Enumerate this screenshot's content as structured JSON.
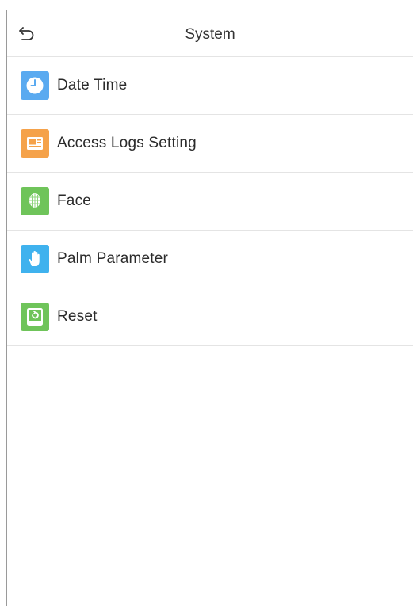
{
  "header": {
    "title": "System",
    "back_icon": "back-arrow-icon"
  },
  "menu": {
    "items": [
      {
        "label": "Date Time",
        "icon": "clock-icon",
        "icon_color": "#5aaaf0"
      },
      {
        "label": "Access Logs Setting",
        "icon": "logs-icon",
        "icon_color": "#f5a24a"
      },
      {
        "label": "Face",
        "icon": "face-icon",
        "icon_color": "#6fc45a"
      },
      {
        "label": "Palm Parameter",
        "icon": "palm-icon",
        "icon_color": "#3fb2ee"
      },
      {
        "label": "Reset",
        "icon": "reset-icon",
        "icon_color": "#6fc45a"
      }
    ]
  }
}
